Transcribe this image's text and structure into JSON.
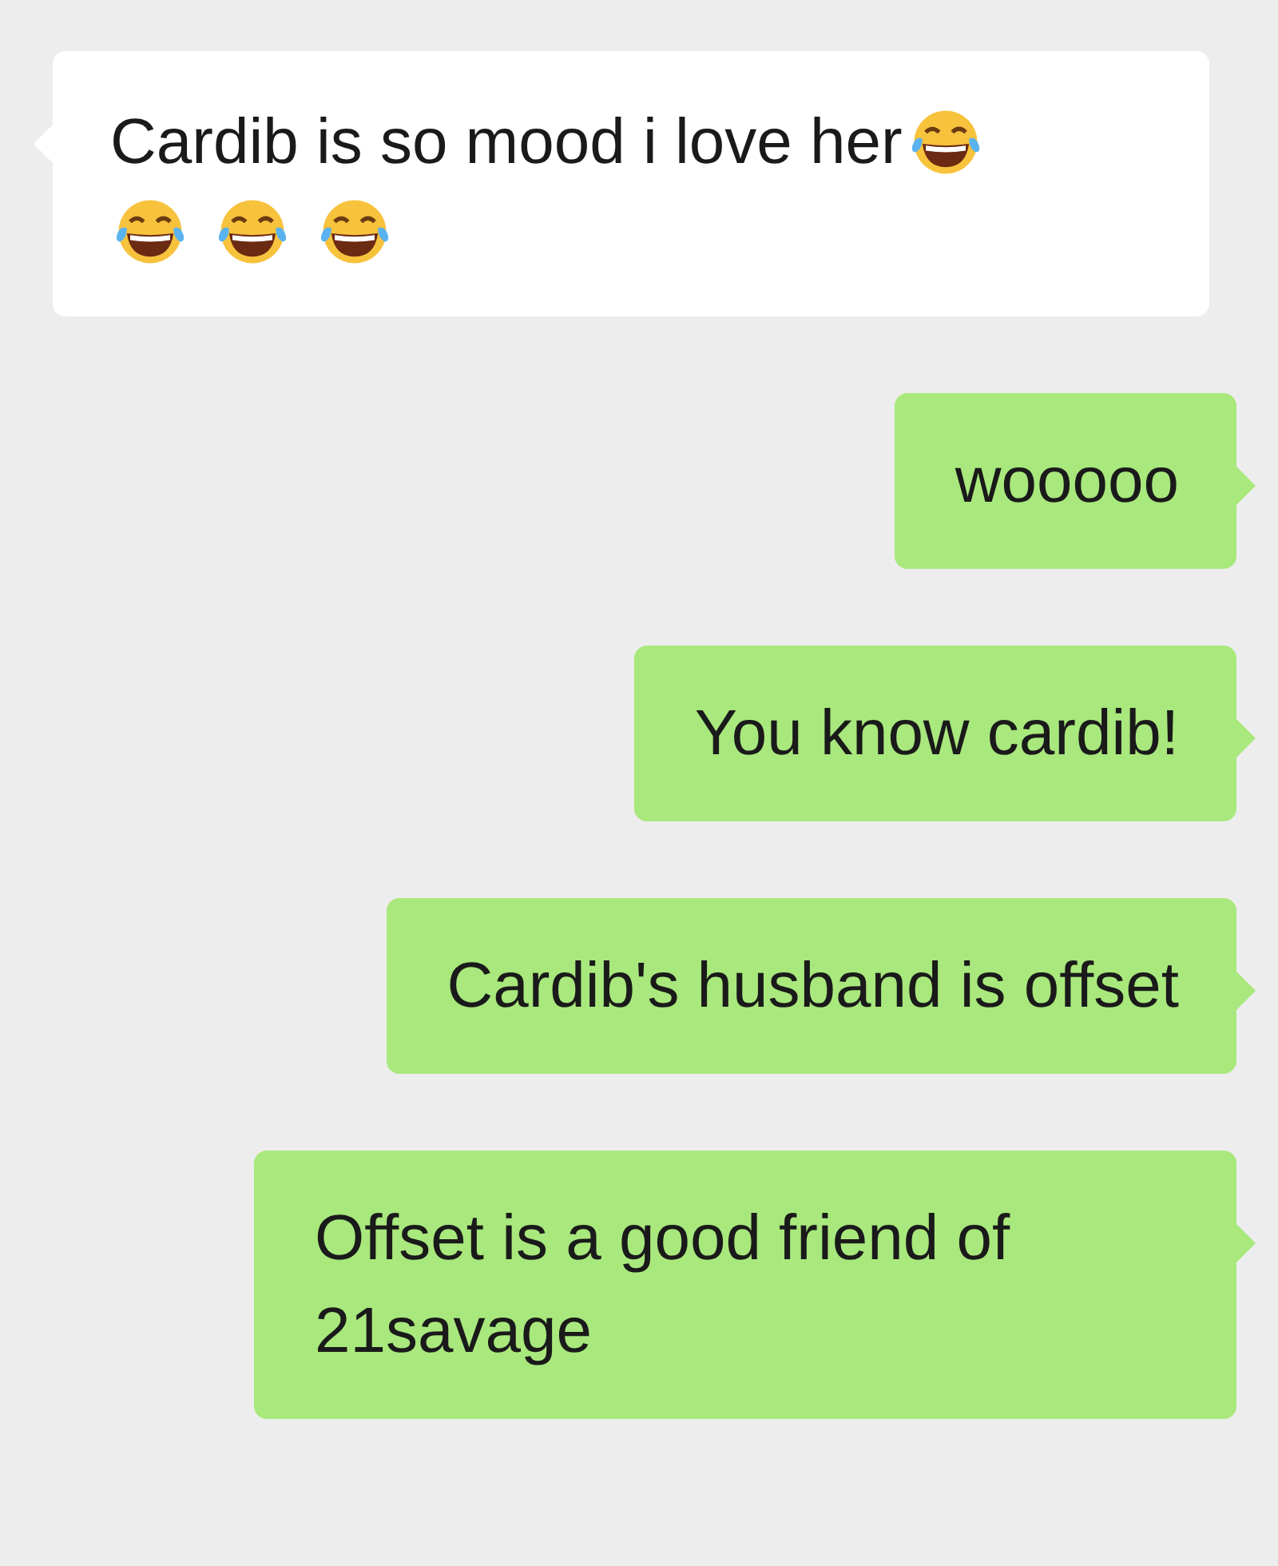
{
  "messages": [
    {
      "kind": "received",
      "text": "Cardib is so mood i love her",
      "emoji": [
        {
          "kind": "tears-of-joy"
        },
        {
          "kind": "tears-of-joy"
        },
        {
          "kind": "tears-of-joy"
        },
        {
          "kind": "tears-of-joy"
        }
      ]
    },
    {
      "kind": "sent",
      "text": "wooooo"
    },
    {
      "kind": "sent",
      "text": "You know cardib!"
    },
    {
      "kind": "sent",
      "text": "Cardib's husband is offset"
    },
    {
      "kind": "sent",
      "text": "Offset is a good friend of 21savage"
    }
  ]
}
